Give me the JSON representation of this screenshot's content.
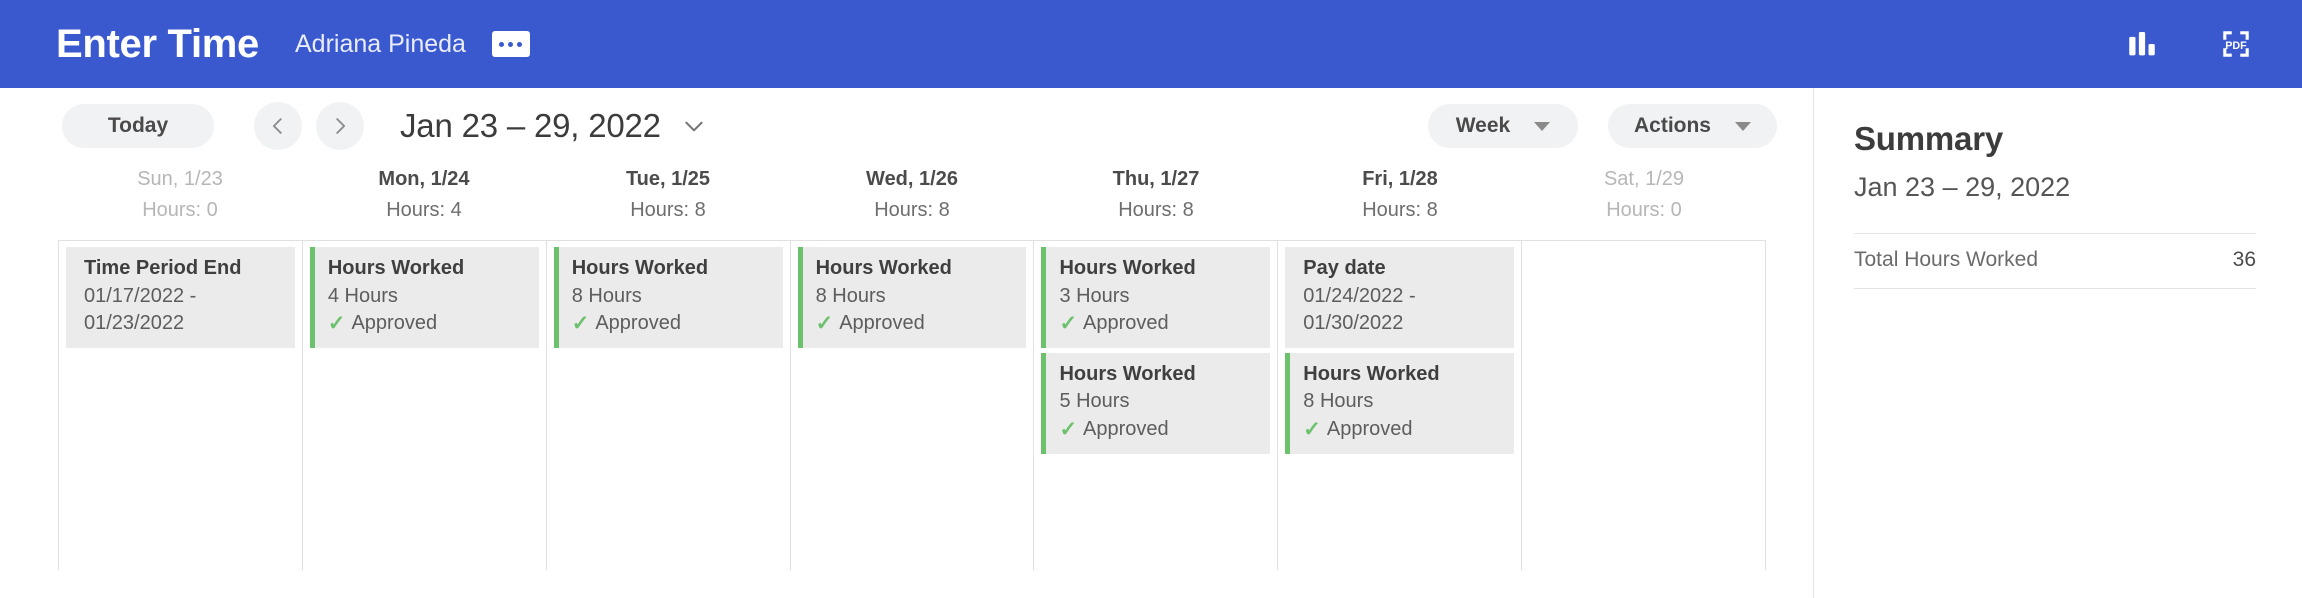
{
  "header": {
    "title": "Enter Time",
    "subject": "Adriana Pineda",
    "related_actions_label": "...",
    "icons": [
      {
        "name": "bar-chart-icon",
        "label": "View Charts"
      },
      {
        "name": "pdf-icon",
        "label": "PDF"
      }
    ],
    "background_color": "#3A59CF"
  },
  "toolbar": {
    "today_label": "Today",
    "prev_label": "Previous week",
    "next_label": "Next week",
    "date_range": "Jan 23 – 29, 2022",
    "view_label": "Week",
    "actions_label": "Actions"
  },
  "calendar": {
    "days": [
      {
        "name": "Sun, 1/23",
        "hours_label": "Hours: 0",
        "hours": 0,
        "inactive": true,
        "events": [
          {
            "title": "Time Period End",
            "line1": "01/17/2022 -",
            "line2": "01/23/2022",
            "status": "",
            "accent": false
          }
        ]
      },
      {
        "name": "Mon, 1/24",
        "hours_label": "Hours: 4",
        "hours": 4,
        "inactive": false,
        "events": [
          {
            "title": "Hours Worked",
            "line1": "4 Hours",
            "line2": "",
            "status": "Approved",
            "accent": true
          }
        ]
      },
      {
        "name": "Tue, 1/25",
        "hours_label": "Hours: 8",
        "hours": 8,
        "inactive": false,
        "events": [
          {
            "title": "Hours Worked",
            "line1": "8 Hours",
            "line2": "",
            "status": "Approved",
            "accent": true
          }
        ]
      },
      {
        "name": "Wed, 1/26",
        "hours_label": "Hours: 8",
        "hours": 8,
        "inactive": false,
        "events": [
          {
            "title": "Hours Worked",
            "line1": "8 Hours",
            "line2": "",
            "status": "Approved",
            "accent": true
          }
        ]
      },
      {
        "name": "Thu, 1/27",
        "hours_label": "Hours: 8",
        "hours": 8,
        "inactive": false,
        "events": [
          {
            "title": "Hours Worked",
            "line1": "3 Hours",
            "line2": "",
            "status": "Approved",
            "accent": true
          },
          {
            "title": "Hours Worked",
            "line1": "5 Hours",
            "line2": "",
            "status": "Approved",
            "accent": true
          }
        ]
      },
      {
        "name": "Fri, 1/28",
        "hours_label": "Hours: 8",
        "hours": 8,
        "inactive": false,
        "events": [
          {
            "title": "Pay date",
            "line1": "01/24/2022 -",
            "line2": "01/30/2022",
            "status": "",
            "accent": false
          },
          {
            "title": "Hours Worked",
            "line1": "8 Hours",
            "line2": "",
            "status": "Approved",
            "accent": true
          }
        ]
      },
      {
        "name": "Sat, 1/29",
        "hours_label": "Hours: 0",
        "hours": 0,
        "inactive": true,
        "events": []
      }
    ],
    "approved_accent_color": "#6CC16C",
    "event_background": "#EBEBEB"
  },
  "summary": {
    "title": "Summary",
    "date_range": "Jan 23 – 29, 2022",
    "rows": [
      {
        "label": "Total Hours Worked",
        "value": "36"
      }
    ]
  }
}
